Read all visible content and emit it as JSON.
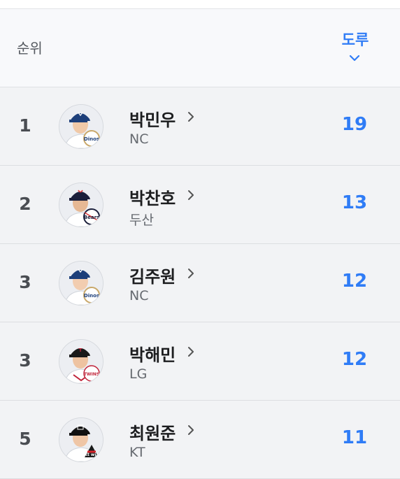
{
  "header": {
    "rank_label": "순위",
    "sort_label": "도루",
    "sort_icon": "chevron-down-icon",
    "accent_color": "#2f7cf6"
  },
  "players": [
    {
      "rank": "1",
      "name": "박민우",
      "team": "NC",
      "value": "19",
      "logo_text": "Dinos",
      "cap_color": "#1d3f7a"
    },
    {
      "rank": "2",
      "name": "박찬호",
      "team": "두산",
      "value": "13",
      "logo_text": "Bears",
      "cap_color": "#1b1f3b"
    },
    {
      "rank": "3",
      "name": "김주원",
      "team": "NC",
      "value": "12",
      "logo_text": "Dinos",
      "cap_color": "#1d3f7a"
    },
    {
      "rank": "3",
      "name": "박해민",
      "team": "LG",
      "value": "12",
      "logo_text": "TWINS",
      "cap_color": "#1a1a1a"
    },
    {
      "rank": "5",
      "name": "최원준",
      "team": "KT",
      "value": "11",
      "logo_text": "kt wiz",
      "cap_color": "#111111"
    }
  ]
}
